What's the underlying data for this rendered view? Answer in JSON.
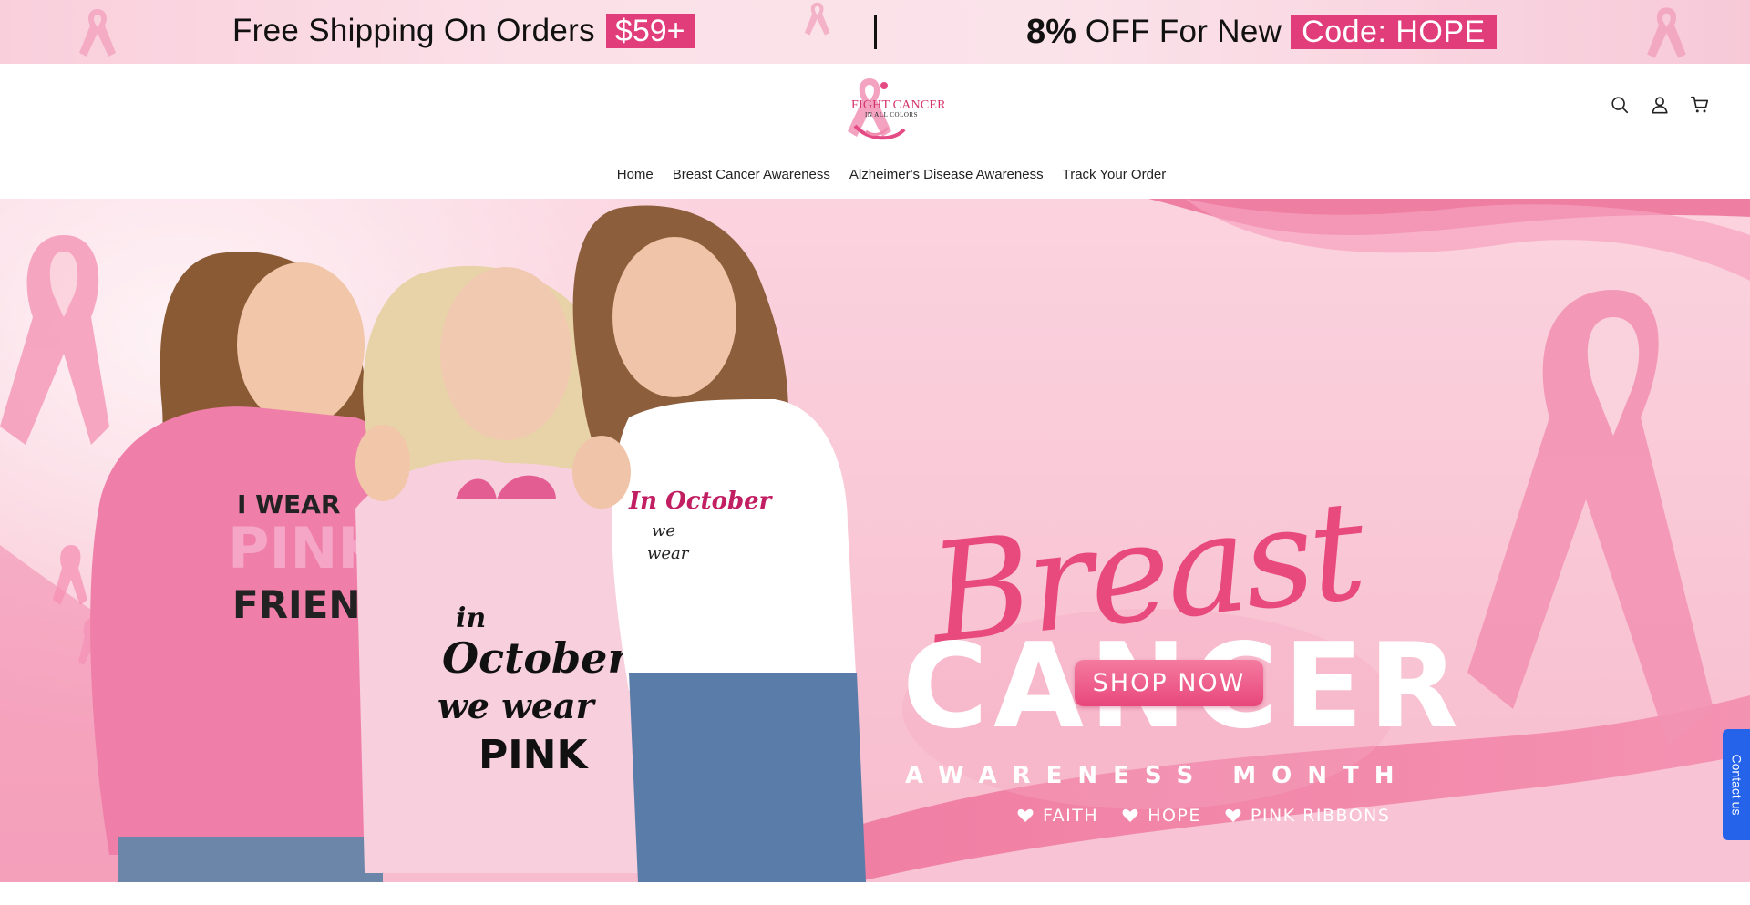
{
  "announcement": {
    "shipping_text": "Free Shipping On Orders",
    "shipping_badge": "$59+",
    "offer_percent": "8%",
    "offer_text": "OFF For New",
    "offer_code": "Code: HOPE"
  },
  "header": {
    "logo_line1": "FIGHT CANCER",
    "logo_line2": "IN ALL COLORS",
    "icons": [
      "search-icon",
      "account-icon",
      "cart-icon"
    ]
  },
  "nav": {
    "items": [
      {
        "label": "Home"
      },
      {
        "label": "Breast Cancer Awareness"
      },
      {
        "label": "Alzheimer's Disease Awareness"
      },
      {
        "label": "Track Your Order"
      }
    ]
  },
  "hero": {
    "script_word": "Breast",
    "headline": "CANCER",
    "subheadline": "AWARENESS MONTH",
    "tags": [
      "FAITH",
      "HOPE",
      "PINK RIBBONS"
    ],
    "cta": "SHOP NOW",
    "shirt_left": [
      "I WEAR",
      "PINK",
      "FRIEND"
    ],
    "shirt_middle": [
      "in",
      "October",
      "we wear",
      "PINK"
    ],
    "shirt_right": [
      "In October",
      "we",
      "wear"
    ]
  },
  "contact": {
    "label": "Contact us"
  },
  "colors": {
    "accent": "#e03d7a",
    "pink_light": "#fbd3df",
    "contact_blue": "#2563eb"
  }
}
